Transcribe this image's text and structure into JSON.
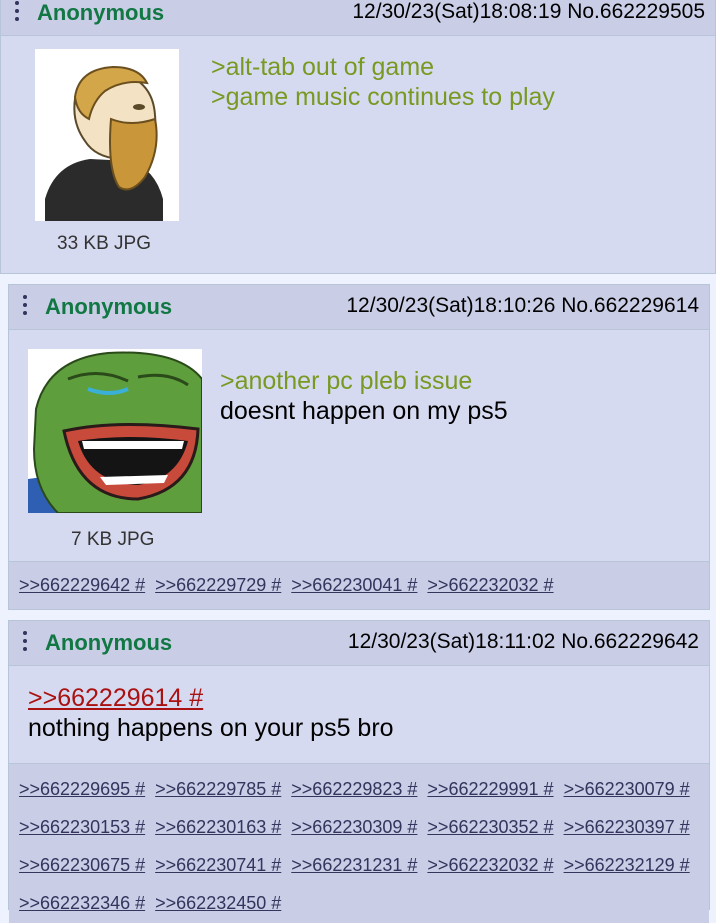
{
  "posts": [
    {
      "name": "Anonymous",
      "meta": "12/30/23(Sat)18:08:19 No.662229505",
      "file_info": "33 KB JPG",
      "thumbnail": "bearded-wojak-icon",
      "greentext": [
        ">alt-tab out of game",
        ">game music continues to play"
      ]
    },
    {
      "name": "Anonymous",
      "meta": "12/30/23(Sat)18:10:26 No.662229614",
      "file_info": "7 KB JPG",
      "thumbnail": "laughing-pepe-icon",
      "greentext": [
        ">another pc pleb issue"
      ],
      "text": "doesnt happen on my ps5",
      "backlinks": [
        ">>662229642 #",
        ">>662229729 #",
        ">>662230041 #",
        ">>662232032 #"
      ]
    },
    {
      "name": "Anonymous",
      "meta": "12/30/23(Sat)18:11:02 No.662229642",
      "quotelink": ">>662229614 #",
      "text": "nothing happens on your ps5 bro",
      "backlinks": [
        [
          ">>662229695 #",
          ">>662229785 #",
          ">>662229823 #",
          ">>662229991 #",
          ">>662230079 #"
        ],
        [
          ">>662230153 #",
          ">>662230163 #",
          ">>662230309 #",
          ">>662230352 #",
          ">>662230397 #"
        ],
        [
          ">>662230675 #",
          ">>662230741 #",
          ">>662231231 #",
          ">>662232032 #",
          ">>662232129 #"
        ],
        [
          ">>662232346 #",
          ">>662232450 #"
        ]
      ]
    }
  ],
  "colors": {
    "post_bg": "#d6daf0",
    "header_bg": "#c9cde6",
    "name": "#117743",
    "greentext": "#789922",
    "quotelink": "#aa1111",
    "backlink": "#34345c"
  }
}
